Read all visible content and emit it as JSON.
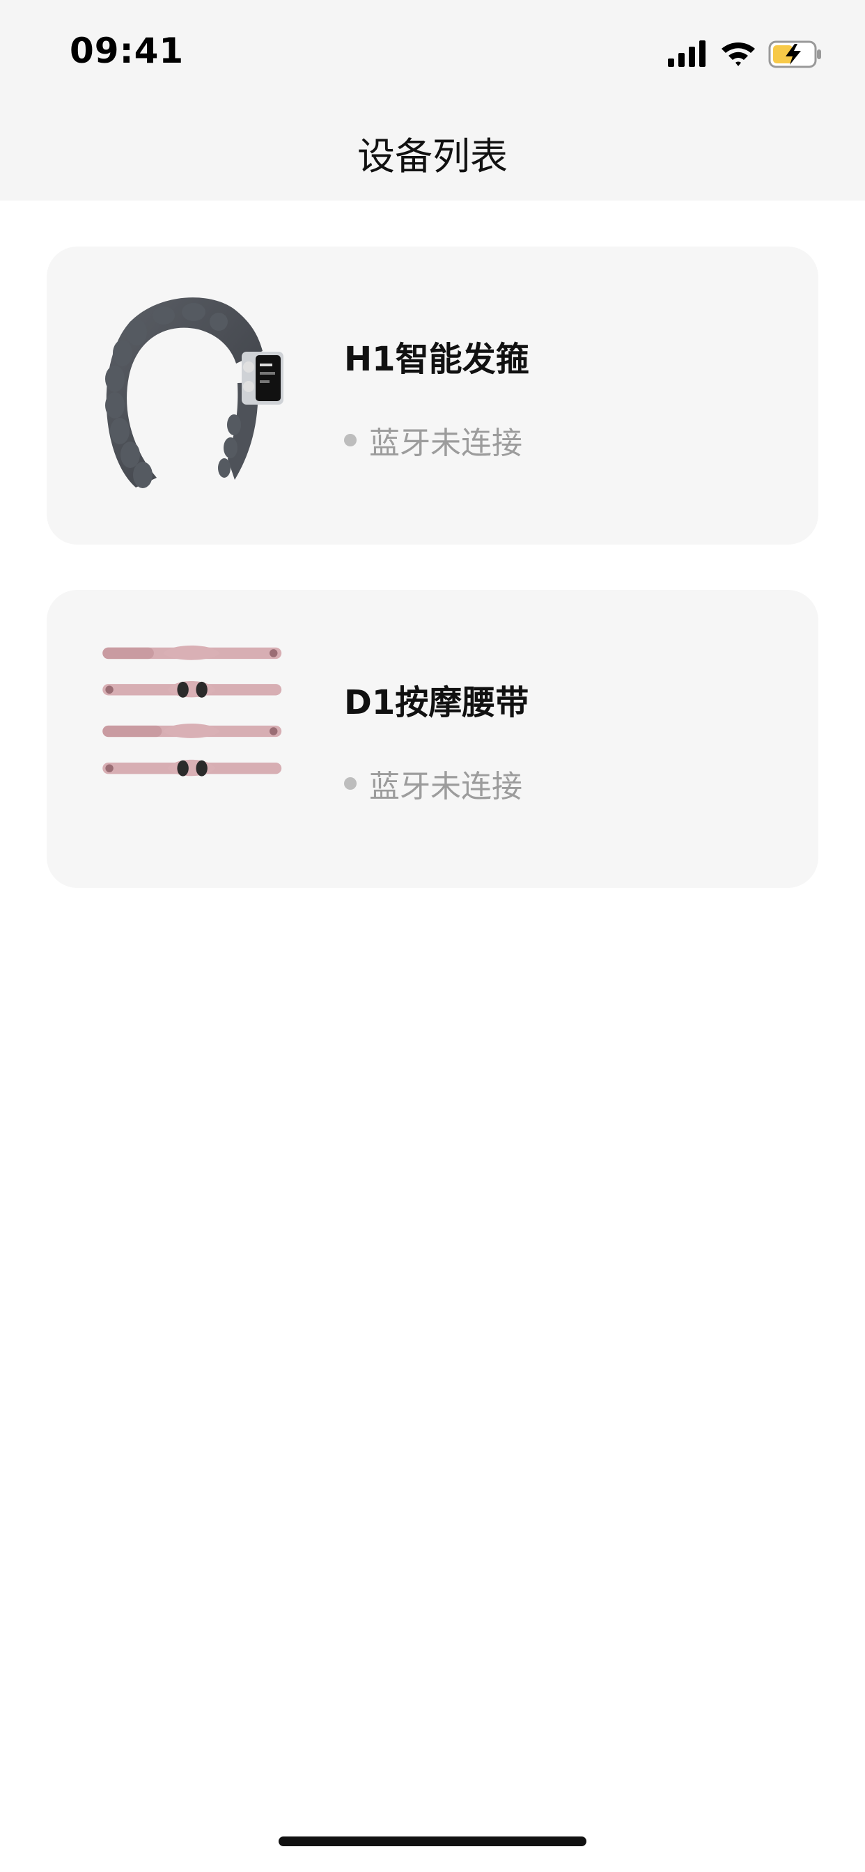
{
  "status_bar": {
    "time": "09:41",
    "signal_icon": "cellular-signal-icon",
    "wifi_icon": "wifi-icon",
    "battery_icon": "battery-charging-icon",
    "battery_color": "#f7c948"
  },
  "header": {
    "title": "设备列表"
  },
  "devices": [
    {
      "name": "H1智能发箍",
      "status": "蓝牙未连接",
      "image": "headband-device-image"
    },
    {
      "name": "D1按摩腰带",
      "status": "蓝牙未连接",
      "image": "massage-belt-image"
    }
  ],
  "colors": {
    "card_background": "#f6f6f6",
    "status_text": "#9c9c9c",
    "status_dot": "#bdbdbd",
    "belt_pink": "#d9aeb4"
  }
}
